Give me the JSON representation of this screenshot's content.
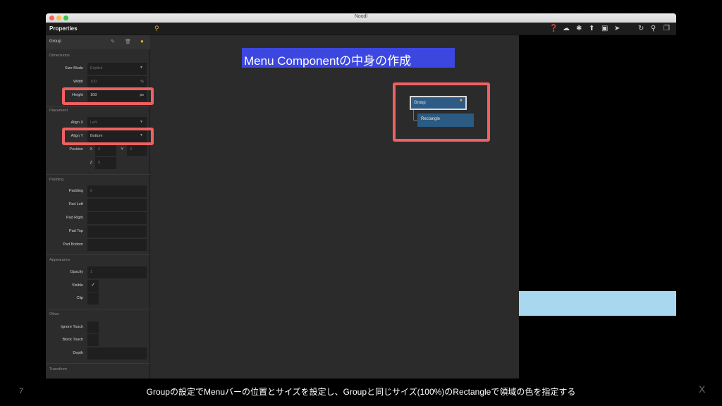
{
  "window": {
    "title": "Noodl"
  },
  "toolbar": {
    "properties_title": "Properties",
    "icons": [
      "help-icon",
      "cloud-icon",
      "bug-icon",
      "upload-icon",
      "preview-icon",
      "send-icon",
      "refresh-icon",
      "search-icon",
      "window-icon"
    ]
  },
  "panel": {
    "group_name": "Group",
    "sections": {
      "dimensions": "Dimensions",
      "placement": "Placement",
      "padding": "Padding",
      "appearance": "Appearance",
      "other": "Other",
      "transform": "Transform"
    },
    "size_mode": {
      "label": "Size Mode",
      "value": "Explicit"
    },
    "width": {
      "label": "Width",
      "value": "100",
      "unit": "%"
    },
    "height": {
      "label": "Height",
      "value": "168",
      "unit": "px"
    },
    "align_x": {
      "label": "Align X",
      "value": "Left"
    },
    "align_y": {
      "label": "Align Y",
      "value": "Bottom"
    },
    "position": {
      "label": "Position",
      "x_label": "X",
      "x_value": "0",
      "y_label": "Y",
      "y_value": "0",
      "z_label": "Z",
      "z_value": "0"
    },
    "padding": {
      "label": "Padding",
      "value": "0"
    },
    "pad_left": {
      "label": "Pad Left"
    },
    "pad_right": {
      "label": "Pad Right"
    },
    "pad_top": {
      "label": "Pad Top"
    },
    "pad_bottom": {
      "label": "Pad Bottom"
    },
    "opacity": {
      "label": "Opacity",
      "value": "1"
    },
    "visible": {
      "label": "Visible",
      "checked": "✓"
    },
    "clip": {
      "label": "Clip"
    },
    "ignore_touch": {
      "label": "Ignore Touch"
    },
    "block_touch": {
      "label": "Block Touch"
    },
    "depth": {
      "label": "Depth"
    }
  },
  "nodes": {
    "group": "Group",
    "rectangle": "Rectangle"
  },
  "slide": {
    "title": "Menu Componentの中身の作成",
    "caption": "Groupの設定でMenuバーの位置とサイズを設定し、Groupと同じサイズ(100%)のRectangleで領域の色を指定する",
    "page_number": "7",
    "corner_mark": "X"
  },
  "colors": {
    "accent_orange": "#f5a623",
    "highlight_red": "#f06060",
    "title_bg": "#3c47e0",
    "node_blue": "#2e5b86",
    "preview_bar": "#a8d8f0"
  }
}
